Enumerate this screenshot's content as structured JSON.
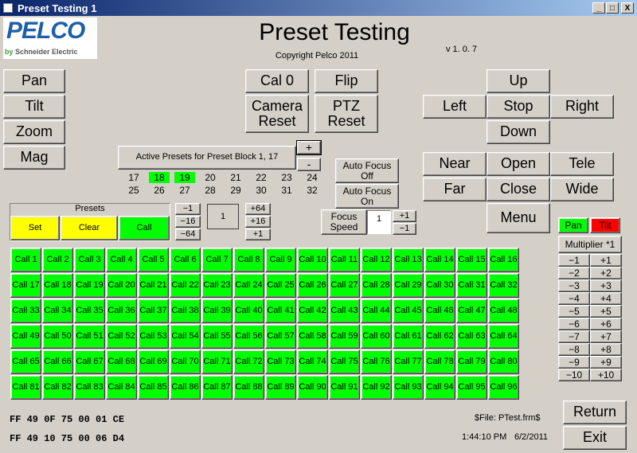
{
  "window": {
    "title": "Preset Testing 1",
    "min": "_",
    "max": "□",
    "close": "X"
  },
  "logo": {
    "brand": "PELCO",
    "sub_prefix": "by ",
    "sub": "Schneider Electric"
  },
  "header": {
    "title": "Preset Testing",
    "copyright": "Copyright Pelco 2011",
    "version": "v 1. 0. 7"
  },
  "left_buttons": [
    "Pan",
    "Tilt",
    "Zoom",
    "Mag"
  ],
  "center_buttons": {
    "cal0": "Cal 0",
    "flip": "Flip",
    "camera_reset_1": "Camera",
    "camera_reset_2": "Reset",
    "ptz_reset_1": "PTZ",
    "ptz_reset_2": "Reset"
  },
  "direction": {
    "up": "Up",
    "left": "Left",
    "stop": "Stop",
    "right": "Right",
    "down": "Down"
  },
  "lens": {
    "near": "Near",
    "open": "Open",
    "tele": "Tele",
    "far": "Far",
    "close": "Close",
    "wide": "Wide",
    "menu": "Menu"
  },
  "active_presets": {
    "label": "Active Presets for Preset Block 1, 17",
    "plus": "+",
    "minus": "-",
    "row1": [
      "17",
      "18",
      "19",
      "20",
      "21",
      "22",
      "23",
      "24"
    ],
    "row2": [
      "25",
      "26",
      "27",
      "28",
      "29",
      "30",
      "31",
      "32"
    ],
    "active": [
      "18",
      "19"
    ]
  },
  "autofocus": {
    "off_1": "Auto Focus",
    "off_2": "Off",
    "on_1": "Auto Focus",
    "on_2": "On"
  },
  "presets_panel": {
    "label": "Presets",
    "set": "Set",
    "clear": "Clear",
    "call": "Call"
  },
  "preset_stepper": {
    "m1": "−1",
    "m16": "−16",
    "m64": "−64",
    "p64": "+64",
    "p16": "+16",
    "p1": "+1",
    "value": "1"
  },
  "focus_speed": {
    "label_1": "Focus",
    "label_2": "Speed",
    "value": "1",
    "plus": "+1",
    "minus": "−1"
  },
  "pan_tilt": {
    "pan": "Pan",
    "tilt": "Tilt",
    "multiplier": "Multiplier *1"
  },
  "multiplier_rows": [
    [
      "−1",
      "+1"
    ],
    [
      "−2",
      "+2"
    ],
    [
      "−3",
      "+3"
    ],
    [
      "−4",
      "+4"
    ],
    [
      "−5",
      "+5"
    ],
    [
      "−6",
      "+6"
    ],
    [
      "−7",
      "+7"
    ],
    [
      "−8",
      "+8"
    ],
    [
      "−9",
      "+9"
    ],
    [
      "−10",
      "+10"
    ]
  ],
  "calls": [
    "Call 1",
    "Call 2",
    "Call 3",
    "Call 4",
    "Call 5",
    "Call 6",
    "Call 7",
    "Call 8",
    "Call 9",
    "Call 10",
    "Call 11",
    "Call 12",
    "Call 13",
    "Call 14",
    "Call 15",
    "Call 16",
    "Call 17",
    "Call 18",
    "Call 19",
    "Call 20",
    "Call 21",
    "Call 22",
    "Call 23",
    "Call 24",
    "Call 25",
    "Call 26",
    "Call 27",
    "Call 28",
    "Call 29",
    "Call 30",
    "Call 31",
    "Call 32",
    "Call 33",
    "Call 34",
    "Call 35",
    "Call 36",
    "Call 37",
    "Call 38",
    "Call 39",
    "Call 40",
    "Call 41",
    "Call 42",
    "Call 43",
    "Call 44",
    "Call 45",
    "Call 46",
    "Call 47",
    "Call 48",
    "Call 49",
    "Call 50",
    "Call 51",
    "Call 52",
    "Call 53",
    "Call 54",
    "Call 55",
    "Call 56",
    "Call 57",
    "Call 58",
    "Call 59",
    "Call 60",
    "Call 61",
    "Call 62",
    "Call 63",
    "Call 64",
    "Call 65",
    "Call 66",
    "Call 67",
    "Call 68",
    "Call 69",
    "Call 70",
    "Call 71",
    "Call 72",
    "Call 73",
    "Call 74",
    "Call 75",
    "Call 76",
    "Call 77",
    "Call 78",
    "Call 79",
    "Call 80",
    "Call 81",
    "Call 82",
    "Call 83",
    "Call 84",
    "Call 85",
    "Call 86",
    "Call 87",
    "Call 88",
    "Call 89",
    "Call 90",
    "Call 91",
    "Call 92",
    "Call 93",
    "Call 94",
    "Call 95",
    "Call 96"
  ],
  "footer": {
    "hex1": "FF 49 0F 75 00 01 CE",
    "hex2": "FF 49 10 75 00 06 D4",
    "file": "$File: PTest.frm$",
    "time": "1:44:10 PM",
    "date": "6/2/2011",
    "return": "Return",
    "exit": "Exit"
  },
  "colors": {
    "face": "#d4d0c8",
    "green": "#00ff00",
    "yellow": "#ffff00",
    "red": "#ff0000",
    "titlebar": "#0a246a"
  }
}
